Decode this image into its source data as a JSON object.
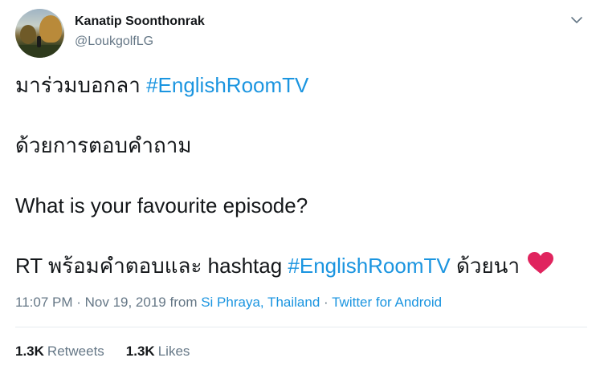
{
  "author": {
    "display_name": "Kanatip Soonthonrak",
    "handle": "@LoukgolfLG"
  },
  "tweet": {
    "line1_text": "มาร่วมบอกลา ",
    "line1_hashtag": "#EnglishRoomTV",
    "line2_text": "ด้วยการตอบคำถาม",
    "line3_text": "What is your favourite episode?",
    "line4_prefix": "RT พร้อมคำตอบและ hashtag ",
    "line4_hashtag": "#EnglishRoomTV",
    "line4_suffix": " ด้วยนา ",
    "emoji": "red-heart"
  },
  "meta": {
    "time": "11:07 PM",
    "separator": " · ",
    "date": "Nov 19, 2019",
    "from_label": " from ",
    "location": "Si Phraya, Thailand",
    "source": "Twitter for Android"
  },
  "stats": {
    "retweets_count": "1.3K",
    "retweets_label": "Retweets",
    "likes_count": "1.3K",
    "likes_label": "Likes"
  },
  "colors": {
    "link": "#1b95e0",
    "secondary_text": "#657786",
    "primary_text": "#14171a",
    "heart": "#e0245e"
  }
}
